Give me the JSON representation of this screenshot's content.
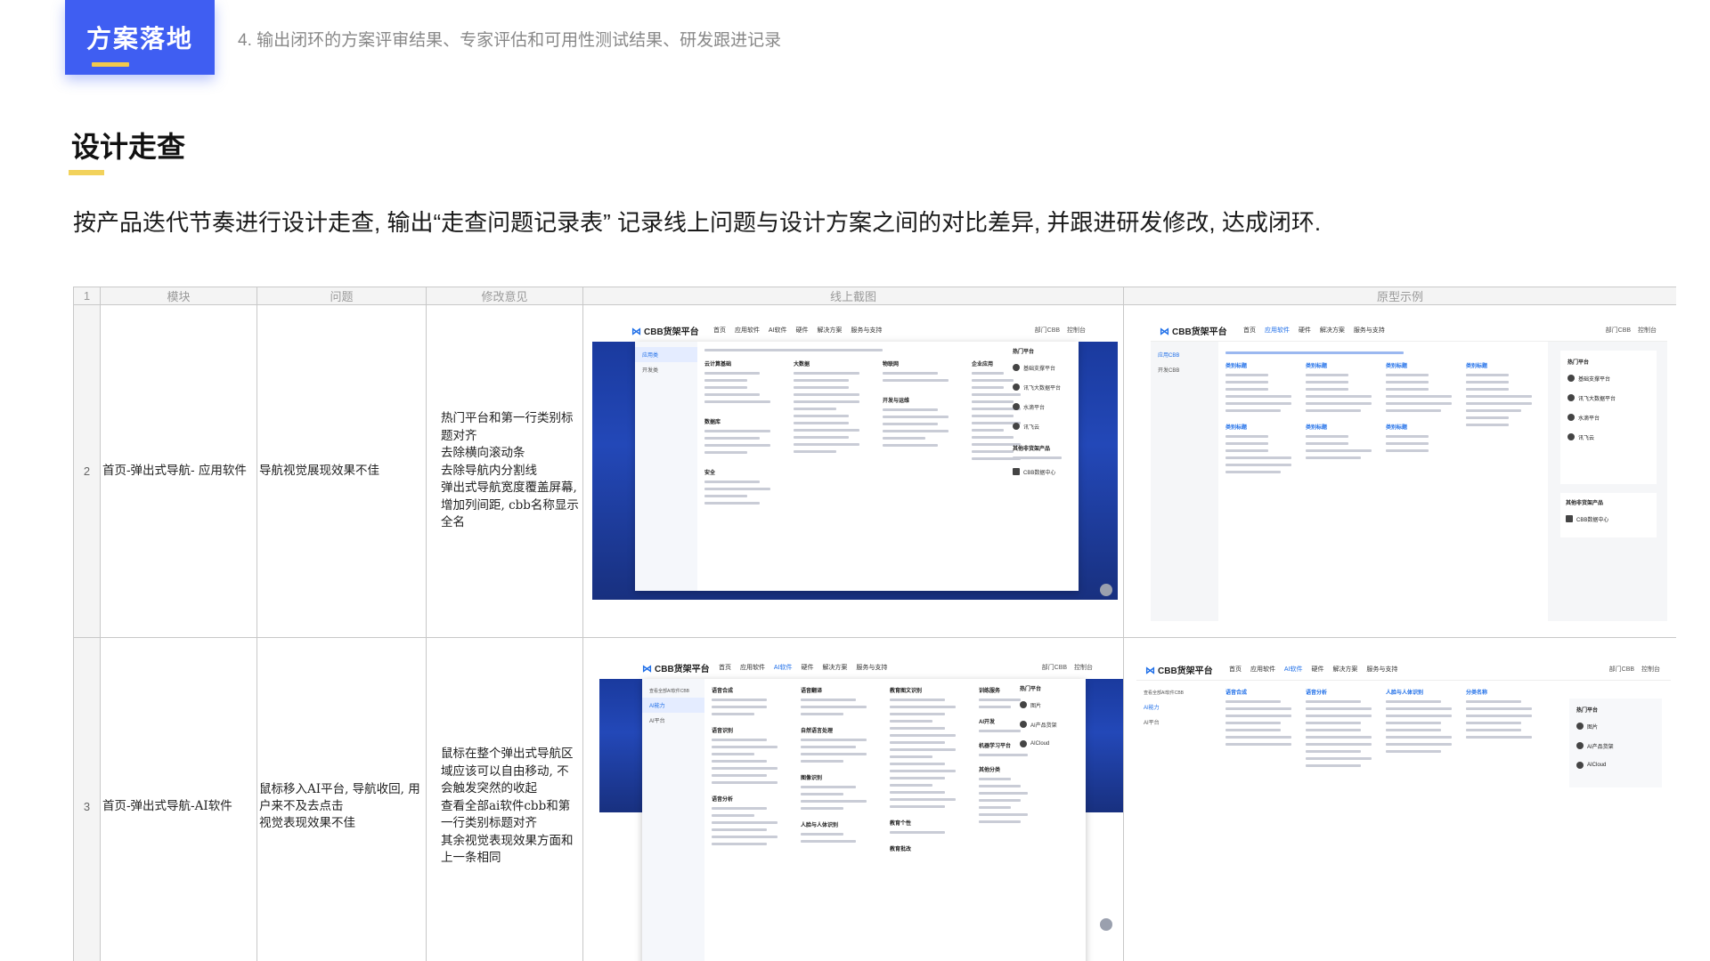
{
  "header": {
    "badge": "方案落地",
    "section_desc": "4. 输出闭环的方案评审结果、专家评估和可用性测试结果、研发跟进记录"
  },
  "title": "设计走查",
  "intro": "按产品迭代节奏进行设计走查, 输出“走查问题记录表” 记录线上问题与设计方案之间的对比差异, 并跟进研发修改, 达成闭环.",
  "table": {
    "header_row_num": "1",
    "columns": [
      "模块",
      "问题",
      "修改意见",
      "线上截图",
      "原型示例"
    ],
    "rows": [
      {
        "num": "2",
        "module": "首页-弹出式导航- 应用软件",
        "issue": "导航视觉展现效果不佳",
        "suggestion": "热门平台和第一行类别标题对齐\n去除横向滚动条\n去除导航内分割线\n弹出式导航宽度覆盖屏幕, 增加列间距, cbb名称显示全名"
      },
      {
        "num": "3",
        "module": "首页-弹出式导航-AI软件",
        "issue": "鼠标移入AI平台, 导航收回, 用户来不及去点击\n视觉表现效果不佳",
        "suggestion": "鼠标在整个弹出式导航区域应该可以自由移动, 不会触发突然的收起\n查看全部ai软件cbb和第一行类别标题对齐\n其余视觉表现效果方面和上一条相同"
      }
    ]
  },
  "mock": {
    "logo": "CBB货架平台",
    "nav_items": [
      "首页",
      "应用软件",
      "AI软件",
      "硬件",
      "解决方案",
      "服务与支持"
    ],
    "nav_right": "部门CBB 控制台",
    "row2_online": {
      "side": [
        "应用类",
        "开发类"
      ],
      "cols": [
        "云计算基础",
        "大数据",
        "物联网",
        "企业应用"
      ],
      "extra_heads": [
        "数据库",
        "安全",
        "开发与运维"
      ],
      "hot_title": "热门平台",
      "hot": [
        "基础支撑平台",
        "讯飞大数据平台",
        "水滴平台",
        "讯飞云"
      ],
      "other": "其他非货架产品",
      "other_item": "CBB数据中心"
    },
    "row2_proto": {
      "side": [
        "应用CBB",
        "开发CBB"
      ],
      "col_head": "类别标题",
      "hot_title": "热门平台",
      "hot": [
        "基础支撑平台",
        "讯飞大数据平台",
        "水滴平台",
        "讯飞云"
      ],
      "other": "其他非货架产品",
      "other_item": "CBB数据中心"
    },
    "row3_online": {
      "side_title": "查看全部AI软件CBB",
      "side": [
        "AI能力",
        "AI平台"
      ],
      "cols": [
        "语音合成",
        "语音翻译",
        "教育图文识别",
        "训练服务"
      ],
      "extra_heads": [
        "语音识别",
        "自然语言处理",
        "图像识别",
        "人脸与人体识别",
        "语音分析",
        "AI开发",
        "机器学习平台",
        "其他分类",
        "教育个性",
        "教育批改"
      ],
      "hot_title": "热门平台",
      "hot": [
        "图片",
        "AI产品货架",
        "AICloud"
      ]
    },
    "row3_proto": {
      "side_title": "查看全部AI软件CBB",
      "side": [
        "AI能力",
        "AI平台"
      ],
      "cols": [
        "语音合成",
        "语音分析",
        "人脸与人体识别",
        "分类名称"
      ],
      "hot_title": "热门平台",
      "hot": [
        "图片",
        "AI产品货架",
        "AICloud"
      ]
    }
  }
}
